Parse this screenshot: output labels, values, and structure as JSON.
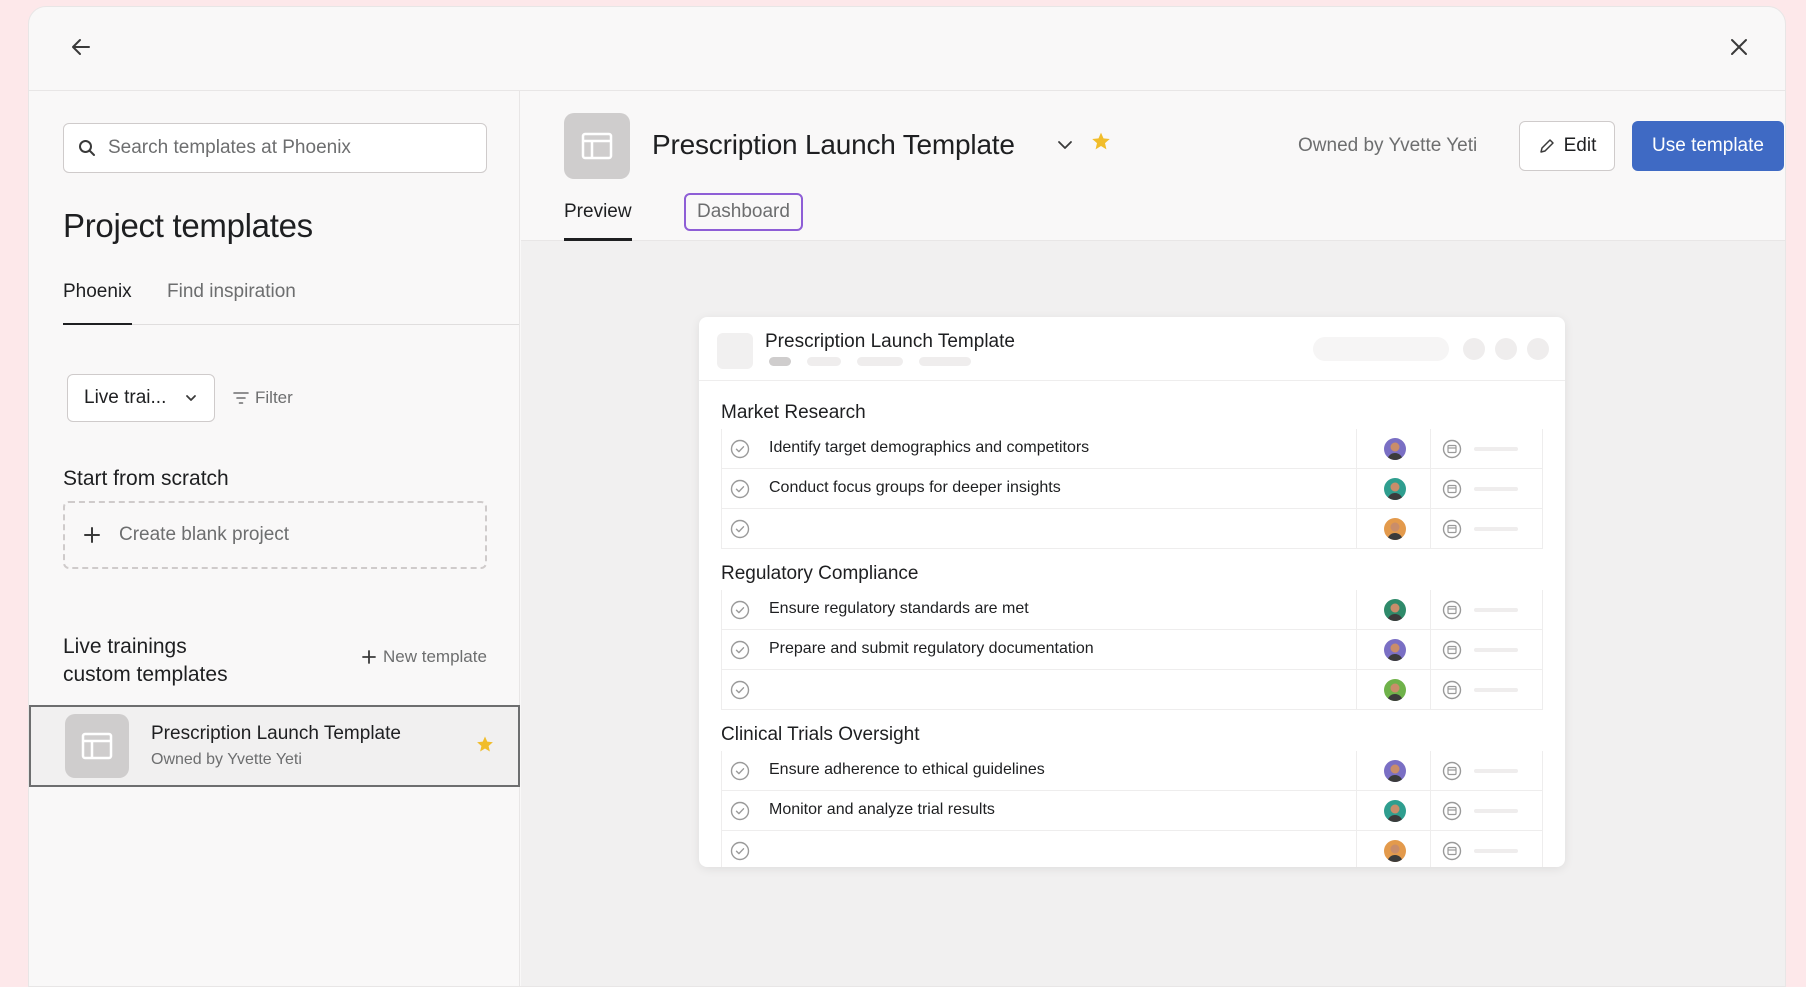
{
  "modal": {
    "back_icon": "arrow-left-icon",
    "close_icon": "close-icon"
  },
  "sidebar": {
    "search_placeholder": "Search templates at Phoenix",
    "title": "Project templates",
    "tabs": [
      {
        "label": "Phoenix",
        "active": true
      },
      {
        "label": "Find inspiration",
        "active": false
      }
    ],
    "dropdown_value": "Live trai...",
    "filter_label": "Filter",
    "scratch_label": "Start from scratch",
    "blank_project_label": "Create blank project",
    "section_label_line1": "Live trainings",
    "section_label_line2": "custom templates",
    "new_template_label": "New template",
    "template": {
      "name": "Prescription Launch Template",
      "owner": "Owned by Yvette Yeti",
      "starred": true
    }
  },
  "main": {
    "title": "Prescription Launch Template",
    "owned_by": "Owned by Yvette Yeti",
    "edit_label": "Edit",
    "use_template_label": "Use template",
    "tabs": [
      {
        "label": "Preview",
        "active": true
      },
      {
        "label": "Dashboard",
        "active": false
      }
    ],
    "preview": {
      "title": "Prescription Launch Template",
      "sections": [
        {
          "title": "Market Research",
          "tasks": [
            {
              "name": "Identify target demographics and competitors",
              "avatar_color": "#7a6fc4"
            },
            {
              "name": "Conduct focus groups for deeper insights",
              "avatar_color": "#2f9e8f"
            },
            {
              "name": "",
              "avatar_color": "#e39a4c"
            }
          ]
        },
        {
          "title": "Regulatory Compliance",
          "tasks": [
            {
              "name": "Ensure regulatory standards are met",
              "avatar_color": "#2f8a6a"
            },
            {
              "name": "Prepare and submit regulatory documentation",
              "avatar_color": "#7a6fc4"
            },
            {
              "name": "",
              "avatar_color": "#6fb24a"
            }
          ]
        },
        {
          "title": "Clinical Trials Oversight",
          "tasks": [
            {
              "name": "Ensure adherence to ethical guidelines",
              "avatar_color": "#7a6fc4"
            },
            {
              "name": "Monitor and analyze trial results",
              "avatar_color": "#2f9e8f"
            },
            {
              "name": "",
              "avatar_color": "#e39a4c"
            }
          ]
        }
      ]
    }
  },
  "colors": {
    "accent": "#3f6ac4",
    "star": "#f1bd2b",
    "focus_outline": "#8e5ed6"
  }
}
